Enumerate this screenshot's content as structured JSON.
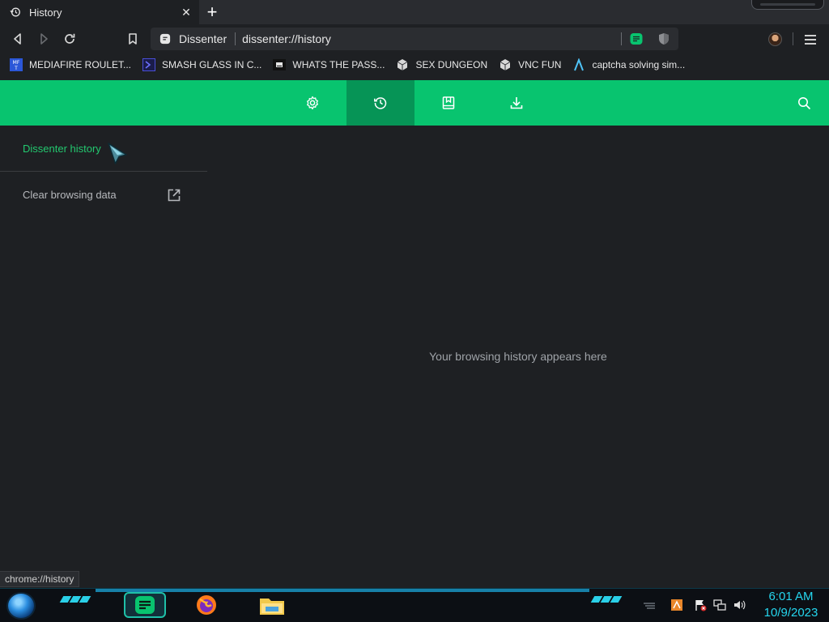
{
  "browser": {
    "tab": {
      "title": "History",
      "close_glyph": "✕"
    },
    "new_tab_glyph": "+",
    "omnibox": {
      "site_name": "Dissenter",
      "url": "dissenter://history"
    }
  },
  "bookmarks": [
    {
      "label": "MEDIAFIRE ROULET...",
      "icon": "mediafire-icon"
    },
    {
      "label": "SMASH GLASS IN C...",
      "icon": "prompt-icon"
    },
    {
      "label": "WHATS THE PASS...",
      "icon": "terminal-icon"
    },
    {
      "label": "SEX DUNGEON",
      "icon": "cube-icon"
    },
    {
      "label": "VNC FUN",
      "icon": "cube-icon"
    },
    {
      "label": "captcha solving sim...",
      "icon": "lambda-icon"
    }
  ],
  "dissenter": {
    "nav": [
      "settings",
      "history",
      "bookmarks",
      "downloads"
    ],
    "active_nav": "history",
    "sidebar": {
      "active_item": "Dissenter history",
      "item": "Clear browsing data"
    },
    "empty_message": "Your browsing history appears here"
  },
  "status_bar": {
    "text": "chrome://history"
  },
  "taskbar": {
    "time": "6:01 AM",
    "date": "10/9/2023"
  },
  "colors": {
    "accent": "#08c46f",
    "accent_active": "#069456",
    "active_text": "#23c86f",
    "background": "#1e2023",
    "clock": "#25d6ee"
  }
}
